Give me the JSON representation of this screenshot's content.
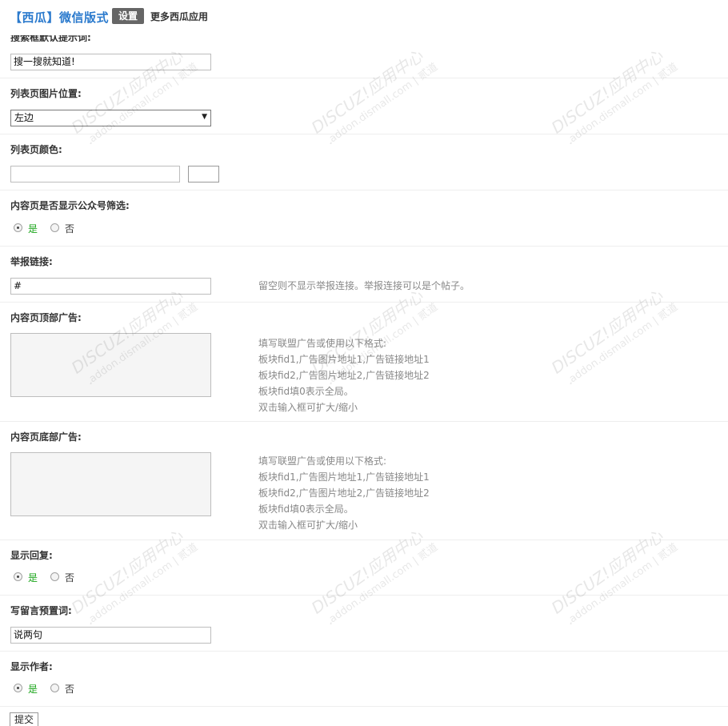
{
  "header": {
    "app_title": "【西瓜】微信版式",
    "tab_settings": "设置",
    "tab_more_apps": "更多西瓜应用"
  },
  "form": {
    "search_default": {
      "label": "搜索框默认提示词:",
      "value": "搜一搜就知道!"
    },
    "list_image_position": {
      "label": "列表页图片位置:",
      "selected": "左边"
    },
    "list_color": {
      "label": "列表页颜色:",
      "value": ""
    },
    "show_account_filter": {
      "label": "内容页是否显示公众号筛选:",
      "yes": "是",
      "no": "否",
      "selected": "yes"
    },
    "report_link": {
      "label": "举报链接:",
      "value": "#",
      "tip": "留空则不显示举报连接。举报连接可以是个帖子。"
    },
    "content_top_ad": {
      "label": "内容页顶部广告:",
      "tip_lines": [
        "填写联盟广告或使用以下格式:",
        "板块fid1,广告图片地址1,广告链接地址1",
        "板块fid2,广告图片地址2,广告链接地址2",
        "板块fid填0表示全局。",
        "双击输入框可扩大/缩小"
      ]
    },
    "content_bottom_ad": {
      "label": "内容页底部广告:",
      "tip_lines": [
        "填写联盟广告或使用以下格式:",
        "板块fid1,广告图片地址1,广告链接地址1",
        "板块fid2,广告图片地址2,广告链接地址2",
        "板块fid填0表示全局。",
        "双击输入框可扩大/缩小"
      ]
    },
    "show_reply": {
      "label": "显示回复:",
      "yes": "是",
      "no": "否",
      "selected": "yes"
    },
    "comment_default": {
      "label": "写留言预置词:",
      "value": "说两句"
    },
    "show_author": {
      "label": "显示作者:",
      "yes": "是",
      "no": "否",
      "selected": "yes"
    },
    "submit_label": "提交"
  },
  "watermark": {
    "brand": "DISCUZ!应用中心",
    "domain": "addon.dismall.com",
    "mark": "贰道",
    "color": "#000000"
  },
  "colors": {
    "title_blue": "#2b7acd",
    "tab_bg": "#666666",
    "radio_yes": "#1aa51a",
    "tip_gray": "#888888"
  }
}
